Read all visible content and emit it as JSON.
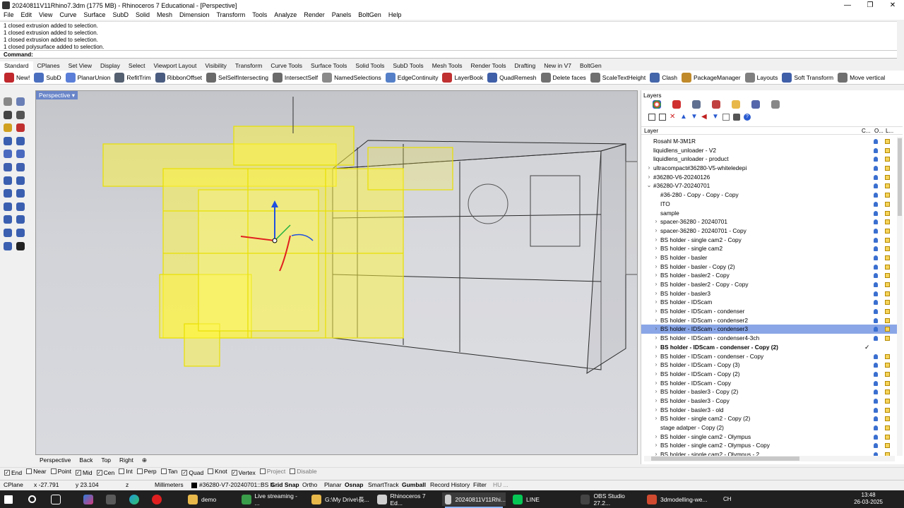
{
  "window": {
    "title": "20240811V11Rhino7.3dm (1775 MB) - Rhinoceros 7 Educational - [Perspective]",
    "buttons": [
      "—",
      "❐",
      "✕"
    ]
  },
  "menu": [
    "File",
    "Edit",
    "View",
    "Curve",
    "Surface",
    "SubD",
    "Solid",
    "Mesh",
    "Dimension",
    "Transform",
    "Tools",
    "Analyze",
    "Render",
    "Panels",
    "BoltGen",
    "Help"
  ],
  "command_history": [
    "1 closed extrusion added to selection.",
    "1 closed extrusion added to selection.",
    "1 closed extrusion added to selection.",
    "1 closed polysurface added to selection."
  ],
  "command_prompt": "Command:",
  "toolbar_tabs": [
    "Standard",
    "CPlanes",
    "Set View",
    "Display",
    "Select",
    "Viewport Layout",
    "Visibility",
    "Transform",
    "Curve Tools",
    "Surface Tools",
    "Solid Tools",
    "SubD Tools",
    "Mesh Tools",
    "Render Tools",
    "Drafting",
    "New in V7",
    "BoltGen"
  ],
  "toolbar_buttons": [
    {
      "label": "New!",
      "color": "#c0282d"
    },
    {
      "label": "SubD",
      "color": "#4b6fbf"
    },
    {
      "label": "PlanarUnion",
      "color": "#5b7fd8"
    },
    {
      "label": "RefitTrim",
      "color": "#556070"
    },
    {
      "label": "RibbonOffset",
      "color": "#4a5c80"
    },
    {
      "label": "SelSelfIntersecting",
      "color": "#6a6a6a"
    },
    {
      "label": "IntersectSelf",
      "color": "#6a6a6a"
    },
    {
      "label": "NamedSelections",
      "color": "#8a8a8a"
    },
    {
      "label": "EdgeContinuity",
      "color": "#5580c8"
    },
    {
      "label": "LayerBook",
      "color": "#c03030"
    },
    {
      "label": "QuadRemesh",
      "color": "#3f5fa8"
    },
    {
      "label": "Delete faces",
      "color": "#707070"
    },
    {
      "label": "ScaleTextHeight",
      "color": "#707070"
    },
    {
      "label": "Clash",
      "color": "#4466aa"
    },
    {
      "label": "PackageManager",
      "color": "#c08a2a"
    },
    {
      "label": "Layouts",
      "color": "#808080"
    },
    {
      "label": "Soft Transform",
      "color": "#3f5fa8"
    },
    {
      "label": "Move vertical",
      "color": "#707070"
    }
  ],
  "viewport": {
    "label": "Perspective ▾",
    "tabs": [
      "Perspective",
      "Back",
      "Top",
      "Right",
      "⊕"
    ]
  },
  "layers": {
    "title": "Layers",
    "col_layer": "Layer",
    "col_a": "C...",
    "col_b": "O...",
    "col_c": "L...",
    "rows": [
      {
        "name": "Rosahl M-3M1R",
        "indent": 0,
        "expander": ""
      },
      {
        "name": "liquidlens_unloader - V2",
        "indent": 0,
        "expander": ""
      },
      {
        "name": "liquidlens_unloader - product",
        "indent": 0,
        "expander": ""
      },
      {
        "name": "ultracompact#36280-V5-whiteledepi",
        "indent": 0,
        "expander": "›"
      },
      {
        "name": "#36280-V6-20240126",
        "indent": 0,
        "expander": "›"
      },
      {
        "name": "#36280-V7-20240701",
        "indent": 0,
        "expander": "⌄"
      },
      {
        "name": "#36-280 - Copy - Copy - Copy",
        "indent": 1,
        "expander": ""
      },
      {
        "name": "ITO",
        "indent": 1,
        "expander": ""
      },
      {
        "name": "sample",
        "indent": 1,
        "expander": ""
      },
      {
        "name": "spacer-36280 - 20240701",
        "indent": 1,
        "expander": "›"
      },
      {
        "name": "spacer-36280 - 20240701 - Copy",
        "indent": 1,
        "expander": "›"
      },
      {
        "name": "BS holder - single cam2 - Copy",
        "indent": 1,
        "expander": "›"
      },
      {
        "name": "BS holder - single cam2",
        "indent": 1,
        "expander": "›"
      },
      {
        "name": "BS holder - basler",
        "indent": 1,
        "expander": "›"
      },
      {
        "name": "BS holder - basler - Copy (2)",
        "indent": 1,
        "expander": "›"
      },
      {
        "name": "BS holder - basler2 - Copy",
        "indent": 1,
        "expander": "›"
      },
      {
        "name": "BS holder - basler2 - Copy - Copy",
        "indent": 1,
        "expander": "›"
      },
      {
        "name": "BS holder - basler3",
        "indent": 1,
        "expander": "›"
      },
      {
        "name": "BS holder - IDScam",
        "indent": 1,
        "expander": "›"
      },
      {
        "name": "BS holder - IDScam - condenser",
        "indent": 1,
        "expander": "›"
      },
      {
        "name": "BS holder - IDScam - condenser2",
        "indent": 1,
        "expander": "›"
      },
      {
        "name": "BS holder - IDScam - condenser3",
        "indent": 1,
        "expander": "›",
        "selected": true
      },
      {
        "name": "BS holder - IDScam - condenser4-3ch",
        "indent": 1,
        "expander": "›"
      },
      {
        "name": "BS holder - IDScam - condenser - Copy (2)",
        "indent": 1,
        "expander": "›",
        "current": true
      },
      {
        "name": "BS holder - IDScam - condenser - Copy",
        "indent": 1,
        "expander": "›"
      },
      {
        "name": "BS holder - IDScam - Copy (3)",
        "indent": 1,
        "expander": "›"
      },
      {
        "name": "BS holder - IDScam - Copy (2)",
        "indent": 1,
        "expander": "›"
      },
      {
        "name": "BS holder - IDScam - Copy",
        "indent": 1,
        "expander": "›"
      },
      {
        "name": "BS holder - basler3 - Copy (2)",
        "indent": 1,
        "expander": "›"
      },
      {
        "name": "BS holder - basler3 - Copy",
        "indent": 1,
        "expander": "›"
      },
      {
        "name": "BS holder - basler3 - old",
        "indent": 1,
        "expander": "›"
      },
      {
        "name": "BS holder - single cam2 - Copy (2)",
        "indent": 1,
        "expander": "›"
      },
      {
        "name": "stage adatper - Copy (2)",
        "indent": 1,
        "expander": ""
      },
      {
        "name": "BS holder - single cam2 - Olympus",
        "indent": 1,
        "expander": "›"
      },
      {
        "name": "BS holder - single cam2 - Olympus - Copy",
        "indent": 1,
        "expander": "›"
      },
      {
        "name": "BS holder - single cam2 - Olympus - 2",
        "indent": 1,
        "expander": "›"
      }
    ]
  },
  "osnap": [
    {
      "label": "End",
      "checked": true
    },
    {
      "label": "Near",
      "checked": false
    },
    {
      "label": "Point",
      "checked": false
    },
    {
      "label": "Mid",
      "checked": true
    },
    {
      "label": "Cen",
      "checked": true
    },
    {
      "label": "Int",
      "checked": false
    },
    {
      "label": "Perp",
      "checked": false
    },
    {
      "label": "Tan",
      "checked": false
    },
    {
      "label": "Quad",
      "checked": true
    },
    {
      "label": "Knot",
      "checked": false
    },
    {
      "label": "Vertex",
      "checked": true
    },
    {
      "label": "Project",
      "checked": false
    },
    {
      "label": "Disable",
      "checked": false
    }
  ],
  "status": {
    "cplane": "CPlane",
    "x": "x -27.791",
    "y": "y 23.104",
    "z": "z",
    "units": "Millimeters",
    "layer": "#36280-V7-20240701::BS h...",
    "grid_snap": "Grid Snap",
    "ortho": "Ortho",
    "planar": "Planar",
    "osnap": "Osnap",
    "smarttrack": "SmartTrack",
    "gumball": "Gumball",
    "record_history": "Record History",
    "filter": "Filter",
    "extra": "HU ..."
  },
  "taskbar": {
    "items": [
      {
        "label": "",
        "color": "#f0c020"
      },
      {
        "label": "demo",
        "color": "#e8b84a"
      },
      {
        "label": "Live streaming - ...",
        "color": "#3a9d4a"
      },
      {
        "label": "G:\\My Drive\\長...",
        "color": "#e8b84a"
      },
      {
        "label": "Rhinoceros 7 Ed...",
        "color": "#d0d0d0"
      },
      {
        "label": "20240811V11Rhi...",
        "color": "#d0d0d0"
      },
      {
        "label": "LINE",
        "color": "#06c755"
      },
      {
        "label": "OBS Studio 27.2...",
        "color": "#444444"
      },
      {
        "label": "3dmodelling-we...",
        "color": "#d04a30"
      }
    ],
    "tray": "CH",
    "time": "13:48",
    "date": "26-03-2025"
  }
}
